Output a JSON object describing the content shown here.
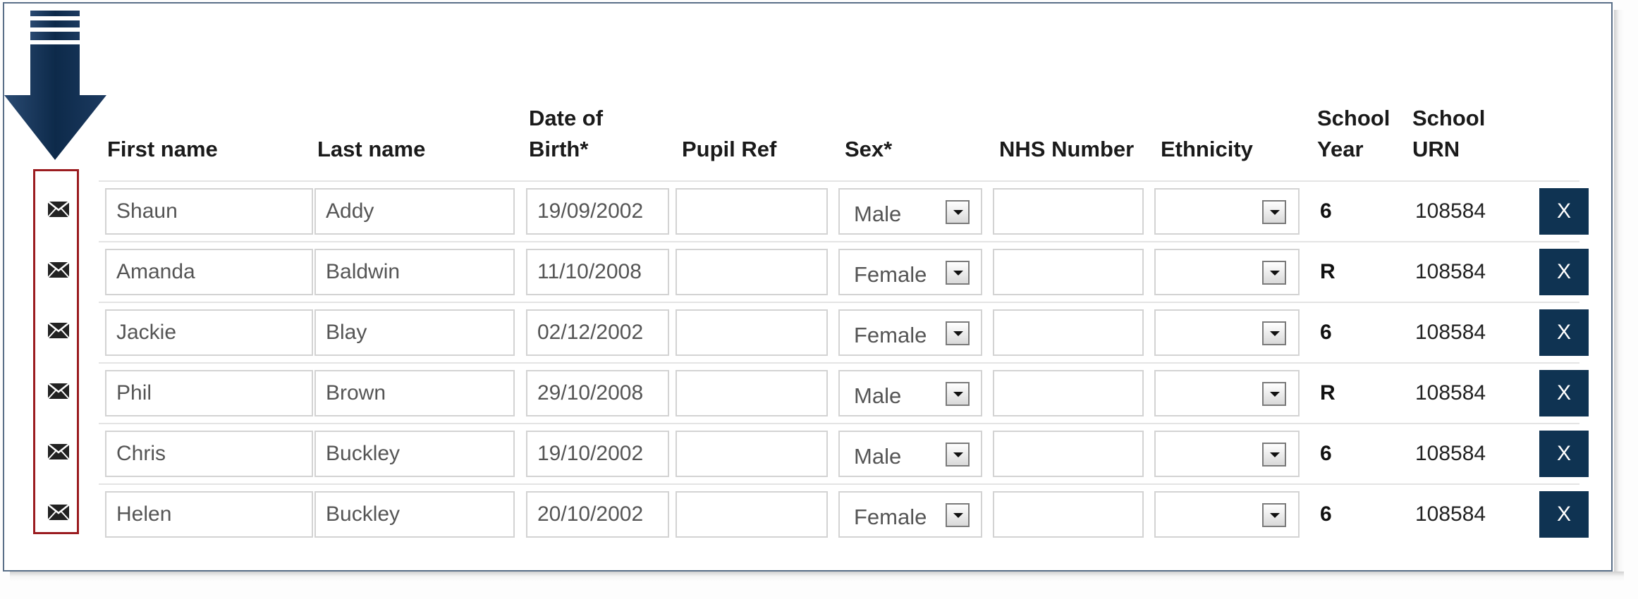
{
  "headers": {
    "first_name": "First name",
    "last_name": "Last name",
    "dob_line1": "Date of",
    "dob_line2": "Birth*",
    "pupil_ref": "Pupil Ref",
    "sex": "Sex*",
    "nhs_number": "NHS Number",
    "ethnicity": "Ethnicity",
    "school_year_line1": "School",
    "school_year_line2": "Year",
    "school_urn_line1": "School",
    "school_urn_line2": "URN"
  },
  "remove_label": "X",
  "colors": {
    "remove_button": "#0f3352",
    "highlight_border": "#9b1c20",
    "arrow": "#0d2a4a"
  },
  "rows": [
    {
      "first_name": "Shaun",
      "last_name": "Addy",
      "dob": "19/09/2002",
      "pupil_ref": "",
      "sex": "Male",
      "nhs_number": "",
      "ethnicity": "",
      "school_year": "6",
      "school_urn": "108584"
    },
    {
      "first_name": "Amanda",
      "last_name": "Baldwin",
      "dob": "11/10/2008",
      "pupil_ref": "",
      "sex": "Female",
      "nhs_number": "",
      "ethnicity": "",
      "school_year": "R",
      "school_urn": "108584"
    },
    {
      "first_name": "Jackie",
      "last_name": "Blay",
      "dob": "02/12/2002",
      "pupil_ref": "",
      "sex": "Female",
      "nhs_number": "",
      "ethnicity": "",
      "school_year": "6",
      "school_urn": "108584"
    },
    {
      "first_name": "Phil",
      "last_name": "Brown",
      "dob": "29/10/2008",
      "pupil_ref": "",
      "sex": "Male",
      "nhs_number": "",
      "ethnicity": "",
      "school_year": "R",
      "school_urn": "108584"
    },
    {
      "first_name": "Chris",
      "last_name": "Buckley",
      "dob": "19/10/2002",
      "pupil_ref": "",
      "sex": "Male",
      "nhs_number": "",
      "ethnicity": "",
      "school_year": "6",
      "school_urn": "108584"
    },
    {
      "first_name": "Helen",
      "last_name": "Buckley",
      "dob": "20/10/2002",
      "pupil_ref": "",
      "sex": "Female",
      "nhs_number": "",
      "ethnicity": "",
      "school_year": "6",
      "school_urn": "108584"
    }
  ]
}
